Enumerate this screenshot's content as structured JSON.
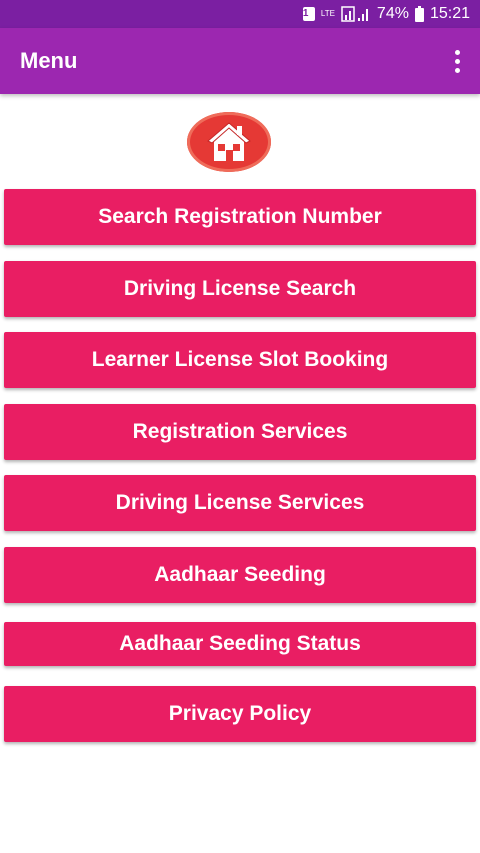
{
  "status_bar": {
    "sim_label": "1",
    "network_label": "LTE",
    "battery": "74%",
    "time": "15:21"
  },
  "app_bar": {
    "title": "Menu",
    "overflow_icon": "more-vert-icon"
  },
  "logo": {
    "icon": "home-icon"
  },
  "menu": {
    "items": [
      {
        "label": "Search Registration Number"
      },
      {
        "label": "Driving License Search"
      },
      {
        "label": "Learner License Slot Booking"
      },
      {
        "label": "Registration Services"
      },
      {
        "label": "Driving License Services"
      },
      {
        "label": "Aadhaar Seeding"
      },
      {
        "label": "Aadhaar Seeding Status"
      },
      {
        "label": "Privacy Policy"
      }
    ]
  },
  "colors": {
    "status_bar": "#7b1fa2",
    "app_bar": "#9c27b0",
    "button": "#e91e63",
    "logo": "#e53935"
  }
}
